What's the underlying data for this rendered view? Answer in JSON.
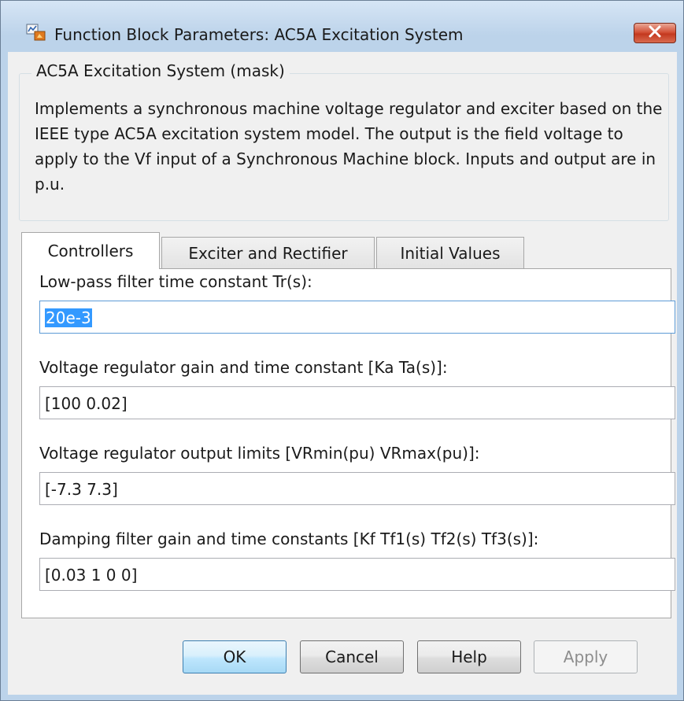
{
  "window": {
    "title": "Function Block Parameters: AC5A Excitation System"
  },
  "mask": {
    "group_title": "AC5A Excitation System (mask)",
    "description": "Implements a synchronous machine voltage regulator and exciter based on the IEEE type AC5A excitation system model. The output is the field voltage to apply to the Vf input of a Synchronous Machine block. Inputs and output are in p.u."
  },
  "tabs": [
    {
      "label": "Controllers",
      "active": true
    },
    {
      "label": "Exciter and Rectifier",
      "active": false
    },
    {
      "label": "Initial Values",
      "active": false
    }
  ],
  "params": [
    {
      "label": "Low-pass filter time constant Tr(s):",
      "value": "20e-3"
    },
    {
      "label": "Voltage regulator gain and time constant [Ka Ta(s)]:",
      "value": "[100 0.02]"
    },
    {
      "label": "Voltage regulator output limits [VRmin(pu) VRmax(pu)]:",
      "value": "[-7.3 7.3]"
    },
    {
      "label": "Damping filter gain and time constants [Kf Tf1(s) Tf2(s) Tf3(s)]:",
      "value": "[0.03 1 0 0]"
    }
  ],
  "buttons": {
    "ok": "OK",
    "cancel": "Cancel",
    "help": "Help",
    "apply": "Apply"
  },
  "icons": {
    "app": "simulink-block-icon",
    "close": "close-x-icon"
  }
}
